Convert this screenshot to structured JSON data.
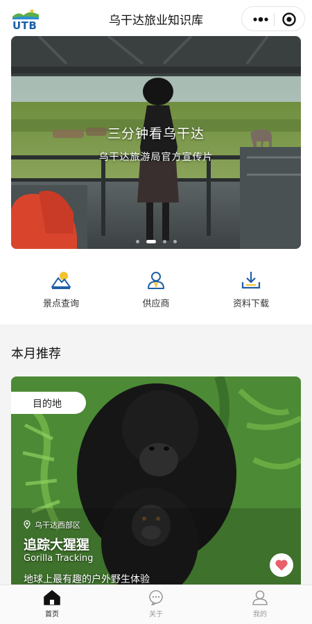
{
  "header": {
    "logo_text": "UTB",
    "title": "乌干达旅业知识库",
    "more_icon": "more-dots-icon",
    "close_icon": "target-circle-icon"
  },
  "banner": {
    "title": "三分钟看乌干达",
    "subtitle": "乌干达旅游局官方宣传片",
    "slide_count": 4,
    "active_slide": 1
  },
  "quick_links": [
    {
      "label": "景点查询",
      "icon": "mountain-sun-icon"
    },
    {
      "label": "供应商",
      "icon": "person-icon"
    },
    {
      "label": "资料下载",
      "icon": "download-icon"
    }
  ],
  "recommend": {
    "section_title": "本月推荐",
    "card": {
      "tag": "目的地",
      "location": "乌干达西部区",
      "title": "追踪大猩猩",
      "subtitle_en": "Gorilla Tracking",
      "description": "地球上最有趣的户外野生体验",
      "favorite_icon": "heart-icon"
    }
  },
  "tabbar": {
    "items": [
      {
        "label": "首页",
        "icon": "home-icon",
        "active": true
      },
      {
        "label": "关于",
        "icon": "chat-bubble-icon",
        "active": false
      },
      {
        "label": "我的",
        "icon": "user-icon",
        "active": false
      }
    ]
  },
  "colors": {
    "accent_blue": "#1f5fa6",
    "sun_yellow": "#f2c230",
    "heart_red": "#e8606a",
    "page_bg": "#f4f4f4"
  }
}
